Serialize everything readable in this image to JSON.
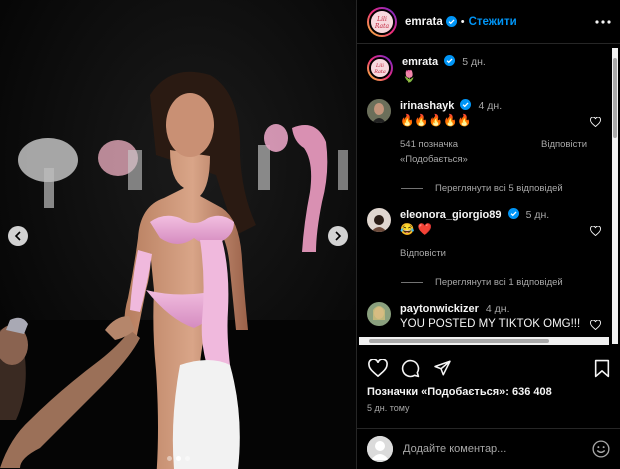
{
  "post": {
    "author": "emrata",
    "author_avatar_text": "Lili Rata",
    "follow_label": "Стежити",
    "caption_time": "5 дн.",
    "caption_text": "🌷",
    "likes_text": "Позначки «Подобається»: 636 408",
    "posted_ago": "5 дн. тому",
    "comment_placeholder": "Додайте коментар...",
    "photo": {
      "slide_count": 3,
      "active_slide": 2
    }
  },
  "comments": [
    {
      "user": "irinashayk",
      "time": "4 дн.",
      "text": "🔥🔥🔥🔥🔥",
      "likes": "541 позначка «Подобається»",
      "reply": "Відповісти",
      "replies_toggle": "Переглянути всі 5 відповідей"
    },
    {
      "user": "eleonora_giorgio89",
      "time": "5 дн.",
      "text": "😂 ❤️",
      "reply": "Відповісти",
      "replies_toggle": "Переглянути всі 1 відповідей"
    },
    {
      "user": "paytonwickizer",
      "time": "4 дн.",
      "text": "YOU POSTED MY TIKTOK OMG!!!"
    }
  ],
  "icons": {
    "verified": "verified-badge-icon",
    "more": "more-horizontal-icon",
    "heart": "heart-icon",
    "comment": "comment-icon",
    "share": "share-icon",
    "save": "bookmark-icon",
    "emoji": "emoji-smile-icon",
    "prev": "chevron-left-icon",
    "next": "chevron-right-icon"
  },
  "colors": {
    "accent": "#0095f6",
    "background": "#000000",
    "secondary_text": "#a8a8a8",
    "heart_red": "#ed4956"
  }
}
